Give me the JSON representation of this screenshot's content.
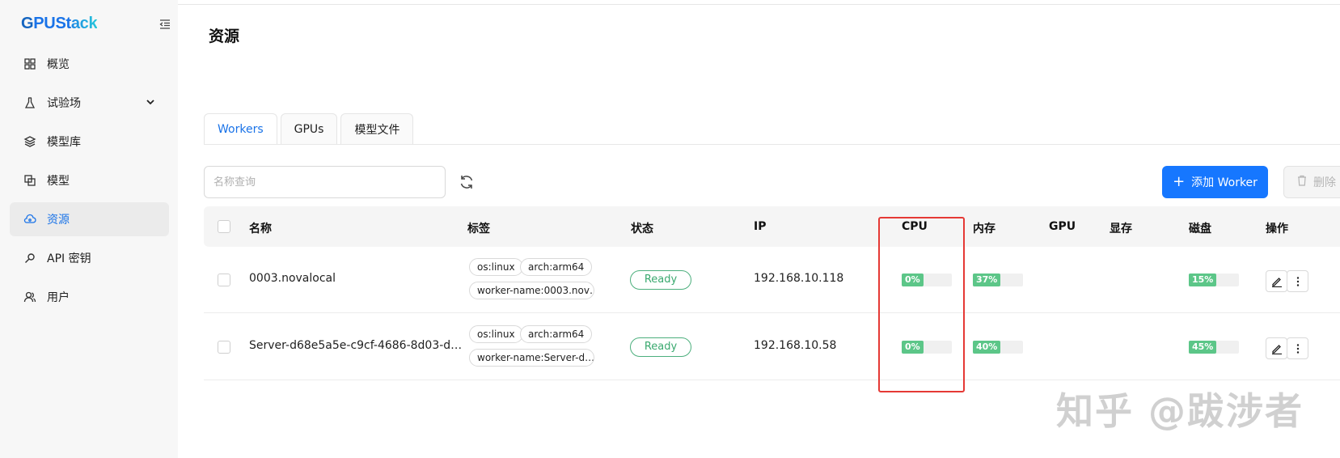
{
  "app": {
    "logo_prefix": "G",
    "logo_mid": "PUSt",
    "logo_tail": "ack"
  },
  "sidebar": {
    "items": [
      {
        "label": "概览",
        "icon": "grid-icon"
      },
      {
        "label": "试验场",
        "icon": "flask-icon",
        "expandable": true
      },
      {
        "label": "模型库",
        "icon": "layers-icon"
      },
      {
        "label": "模型",
        "icon": "copy-icon"
      },
      {
        "label": "资源",
        "icon": "cloud-icon",
        "active": true
      },
      {
        "label": "API 密钥",
        "icon": "key-icon"
      },
      {
        "label": "用户",
        "icon": "users-icon"
      }
    ]
  },
  "page": {
    "title": "资源"
  },
  "tabs": [
    {
      "label": "Workers",
      "active": true
    },
    {
      "label": "GPUs"
    },
    {
      "label": "模型文件"
    }
  ],
  "toolbar": {
    "search_placeholder": "名称查询",
    "add_label": "添加 Worker",
    "delete_label": "删除"
  },
  "table": {
    "columns": [
      "名称",
      "标签",
      "状态",
      "IP",
      "CPU",
      "内存",
      "GPU",
      "显存",
      "磁盘",
      "操作"
    ],
    "rows": [
      {
        "name": "0003.novalocal",
        "tags": [
          "os:linux",
          "arch:arm64",
          "worker-name:0003.nov…"
        ],
        "status": "Ready",
        "ip": "192.168.10.118",
        "cpu": "0%",
        "memory": "37%",
        "disk": "15%"
      },
      {
        "name": "Server-d68e5a5e-c9cf-4686-8d03-d…",
        "tags": [
          "os:linux",
          "arch:arm64",
          "worker-name:Server-d…"
        ],
        "status": "Ready",
        "ip": "192.168.10.58",
        "cpu": "0%",
        "memory": "40%",
        "disk": "45%"
      }
    ]
  },
  "watermark": "知乎 @跋涉者",
  "colors": {
    "accent": "#1677ff",
    "status_green": "#3aa96f",
    "progress_green": "#5cc688",
    "highlight_red": "#e53935"
  }
}
